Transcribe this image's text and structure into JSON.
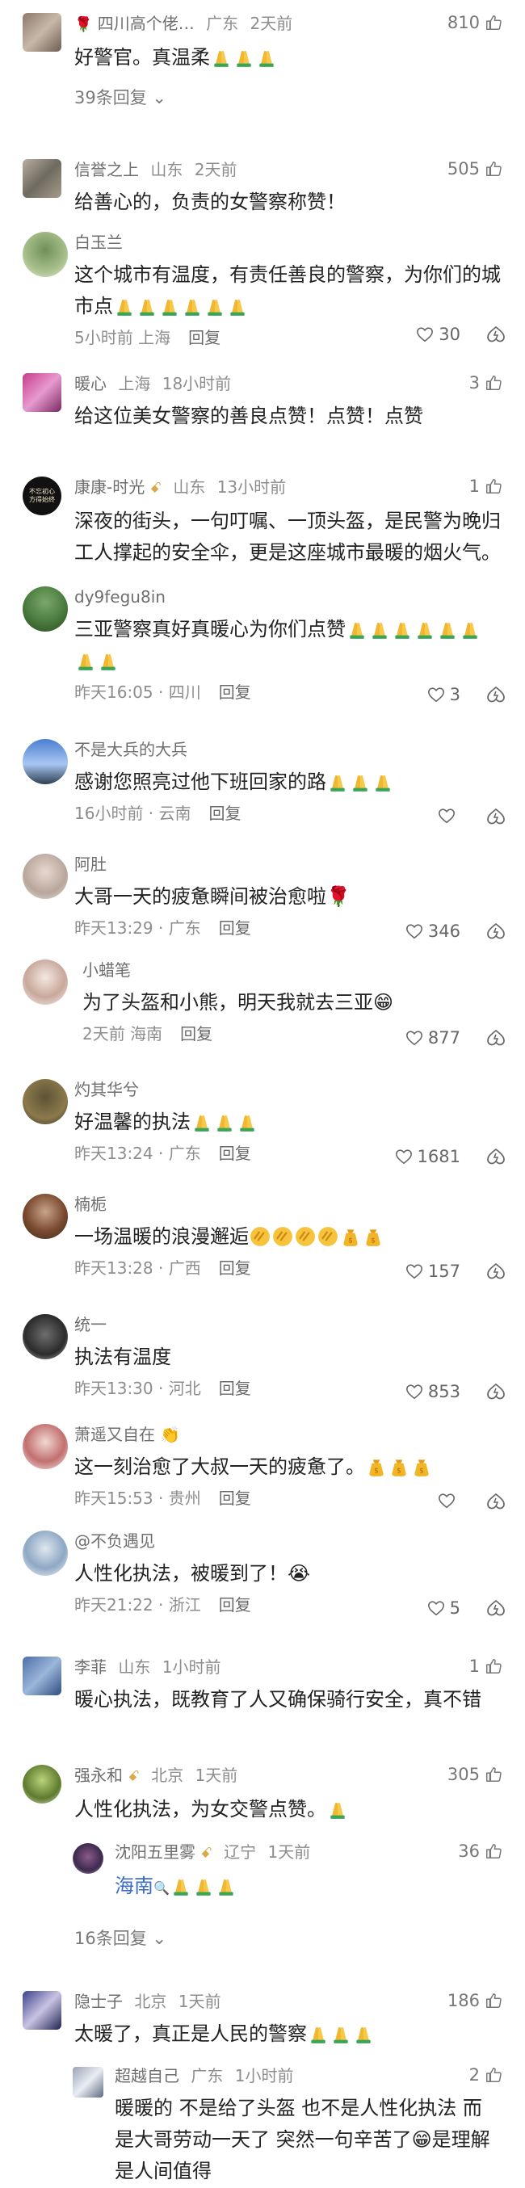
{
  "comments": [
    {
      "name": "四川高个佬…",
      "location": "广东",
      "time": "2天前",
      "text": "好警官。真温柔",
      "likes": "810",
      "more": "39条回复",
      "has_rose": true
    },
    {
      "name": "信誉之上",
      "location": "山东",
      "time": "2天前",
      "text": "给善心的，负责的女警察称赞！",
      "likes": "505",
      "reply": {
        "name": "白玉兰",
        "text": "这个城市有温度，有责任善良的警察，为你们的城市点",
        "time": "5小时前",
        "location": "上海",
        "reply_label": "回复",
        "likes": "30"
      }
    },
    {
      "name": "暖心",
      "location": "上海",
      "time": "18小时前",
      "text": "给这位美女警察的善良点赞！点赞！点赞",
      "likes": "3"
    },
    {
      "name": "康康-时光",
      "location": "山东",
      "time": "13小时前",
      "text": "深夜的街头，一句叮嘱、一顶头盔，是民警为晚归工人撑起的安全伞，更是这座城市最暖的烟火气。",
      "likes": "1",
      "avatar_text": "不忘初心方得始终",
      "replies": [
        {
          "name": "dy9fegu8in",
          "text": "三亚警察真好真暖心为你们点赞",
          "time": "昨天16:05",
          "location": "四川",
          "reply_label": "回复",
          "likes": "3"
        },
        {
          "name": "不是大兵的大兵",
          "text": "感谢您照亮过他下班回家的路",
          "time": "16小时前",
          "location": "云南",
          "reply_label": "回复",
          "likes": ""
        },
        {
          "name": "阿肚",
          "text": "大哥一天的疲惫瞬间被治愈啦",
          "time": "昨天13:29",
          "location": "广东",
          "reply_label": "回复",
          "likes": "346"
        },
        {
          "name": "小蜡笔",
          "text": "为了头盔和小熊，明天我就去三亚",
          "time": "2天前",
          "location": "海南",
          "reply_label": "回复",
          "likes": "877"
        },
        {
          "name": "灼其华兮",
          "text": "好温馨的执法",
          "time": "昨天13:24",
          "location": "广东",
          "reply_label": "回复",
          "likes": "1681"
        },
        {
          "name": "楠栀",
          "text": "一场温暖的浪漫邂逅",
          "time": "昨天13:28",
          "location": "广西",
          "reply_label": "回复",
          "likes": "157"
        },
        {
          "name": "统一",
          "text": "执法有温度",
          "time": "昨天13:30",
          "location": "河北",
          "reply_label": "回复",
          "likes": "853"
        },
        {
          "name": "萧遥又自在",
          "text": "这一刻治愈了大叔一天的疲惫了。",
          "time": "昨天15:53",
          "location": "贵州",
          "reply_label": "回复",
          "likes": ""
        },
        {
          "name": "@不负遇见",
          "text": "人性化执法，被暖到了！",
          "time": "昨天21:22",
          "location": "浙江",
          "reply_label": "回复",
          "likes": "5"
        }
      ]
    },
    {
      "name": "李菲",
      "location": "山东",
      "time": "1小时前",
      "text": "暖心执法，既教育了人又确保骑行安全，真不错",
      "likes": "1"
    },
    {
      "name": "强永和",
      "location": "北京",
      "time": "1天前",
      "text": "人性化执法，为女交警点赞。",
      "likes": "305",
      "sub": {
        "name": "沈阳五里雾",
        "location": "辽宁",
        "time": "1天前",
        "prefix": "海南",
        "likes": "36"
      },
      "more": "16条回复"
    },
    {
      "name": "隐士子",
      "location": "北京",
      "time": "1天前",
      "text": "太暖了，真正是人民的警察",
      "likes": "186",
      "sub": {
        "name": "超越自己",
        "location": "广东",
        "time": "1小时前",
        "text": "暖暖的 不是给了头盔 也不是人性化执法 而是大哥劳动一天了 突然一句辛苦了",
        "text2": "是理解是人间值得",
        "likes": "2"
      }
    }
  ],
  "colors": {
    "accent": "#3b6cc7",
    "meta": "#8d8d8d",
    "text": "#222222"
  },
  "icons": [
    "thumb-up-icon",
    "heart-icon",
    "dislike-icon",
    "chevron-down-icon",
    "rose-icon",
    "clap-emoji",
    "folded-hands-emoji",
    "wealth-bag-emoji",
    "grinning-emoji",
    "crying-emoji"
  ]
}
